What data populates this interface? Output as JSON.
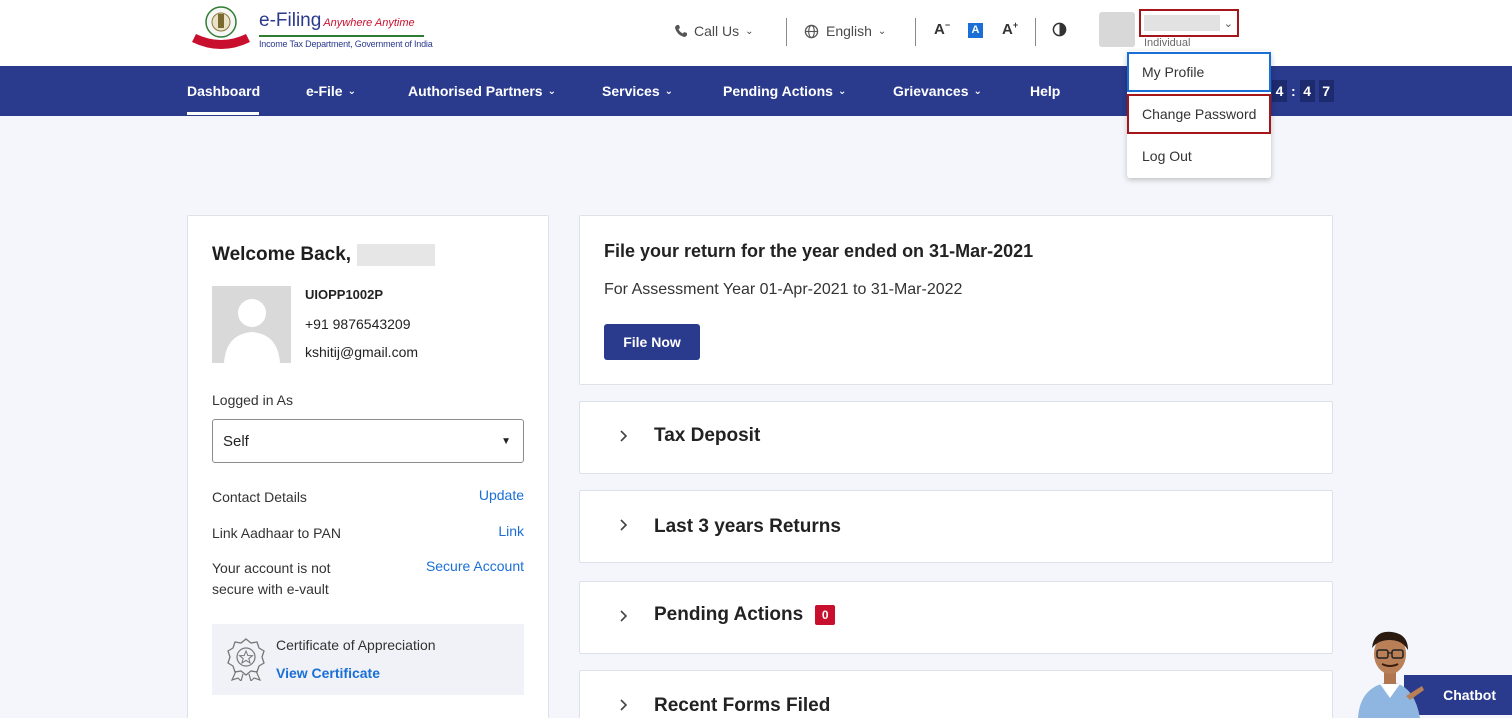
{
  "header": {
    "brand_name": "e-Filing",
    "brand_tagline": "Anywhere Anytime",
    "brand_sub": "Income Tax Department, Government of India",
    "call_us": "Call Us",
    "language": "English",
    "font_decrease": "A",
    "font_normal": "A",
    "font_increase": "A",
    "user_role": "Individual"
  },
  "nav": {
    "items": [
      {
        "label": "Dashboard",
        "has_menu": false
      },
      {
        "label": "e-File",
        "has_menu": true
      },
      {
        "label": "Authorised Partners",
        "has_menu": true
      },
      {
        "label": "Services",
        "has_menu": true
      },
      {
        "label": "Pending Actions",
        "has_menu": true
      },
      {
        "label": "Grievances",
        "has_menu": true
      },
      {
        "label": "Help",
        "has_menu": false
      }
    ],
    "timer_digits": [
      "4",
      "4",
      "7"
    ],
    "timer_sep": ":"
  },
  "user_menu": {
    "items": [
      "My Profile",
      "Change Password",
      "Log Out"
    ]
  },
  "profile": {
    "welcome": "Welcome Back,",
    "pan": "UIOPP1002P",
    "phone": "+91 9876543209",
    "email": "kshitij@gmail.com",
    "logged_in_as_label": "Logged in As",
    "logged_in_as_value": "Self",
    "contact_label": "Contact Details",
    "contact_link": "Update",
    "aadhaar_label": "Link Aadhaar to PAN",
    "aadhaar_link": "Link",
    "secure_label_1": "Your account is not",
    "secure_label_2": "secure with e-vault",
    "secure_link": "Secure Account",
    "cert_title": "Certificate of Appreciation",
    "cert_link": "View Certificate"
  },
  "main": {
    "file_title": "File your return for the year ended on 31-Mar-2021",
    "file_sub": "For Assessment Year 01-Apr-2021 to 31-Mar-2022",
    "file_button": "File Now",
    "accordions": [
      {
        "title": "Tax Deposit"
      },
      {
        "title": "Last 3 years Returns"
      },
      {
        "title": "Pending Actions",
        "badge": "0"
      },
      {
        "title": "Recent Forms Filed"
      }
    ]
  },
  "chatbot": {
    "label": "Chatbot"
  },
  "colors": {
    "primary": "#2a3a8c",
    "link": "#1a6fd6",
    "highlight": "#a4161a",
    "badge": "#c8102e"
  }
}
